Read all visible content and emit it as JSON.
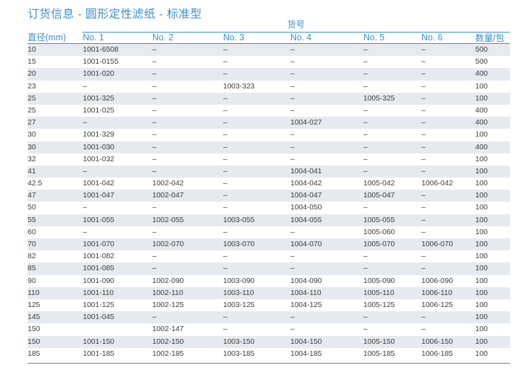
{
  "title": "订货信息 - 圆形定性滤纸 - 标准型",
  "group_header": "货号",
  "columns": {
    "diameter": "直径(mm)",
    "no1": "No. 1",
    "no2": "No. 2",
    "no3": "No. 3",
    "no4": "No. 4",
    "no5": "No. 5",
    "no6": "No. 6",
    "qty": "数量/包"
  },
  "rows": [
    {
      "d": "10",
      "n1": "1001-6508",
      "n2": "–",
      "n3": "–",
      "n4": "–",
      "n5": "–",
      "n6": "–",
      "q": "500"
    },
    {
      "d": "15",
      "n1": "1001-0155",
      "n2": "–",
      "n3": "–",
      "n4": "–",
      "n5": "–",
      "n6": "–",
      "q": "500"
    },
    {
      "d": "20",
      "n1": "1001-020",
      "n2": "–",
      "n3": "–",
      "n4": "–",
      "n5": "–",
      "n6": "–",
      "q": "400"
    },
    {
      "d": "23",
      "n1": "–",
      "n2": "–",
      "n3": "1003-323",
      "n4": "–",
      "n5": "–",
      "n6": "–",
      "q": "100"
    },
    {
      "d": "25",
      "n1": "1001-325",
      "n2": "–",
      "n3": "–",
      "n4": "–",
      "n5": "1005-325",
      "n6": "–",
      "q": "100"
    },
    {
      "d": "25",
      "n1": "1001-025",
      "n2": "–",
      "n3": "–",
      "n4": "–",
      "n5": "–",
      "n6": "–",
      "q": "400"
    },
    {
      "d": "27",
      "n1": "–",
      "n2": "–",
      "n3": "–",
      "n4": "1004-027",
      "n5": "–",
      "n6": "–",
      "q": "400"
    },
    {
      "d": "30",
      "n1": "1001-329",
      "n2": "–",
      "n3": "–",
      "n4": "–",
      "n5": "–",
      "n6": "–",
      "q": "100"
    },
    {
      "d": "30",
      "n1": "1001-030",
      "n2": "–",
      "n3": "–",
      "n4": "–",
      "n5": "–",
      "n6": "–",
      "q": "400"
    },
    {
      "d": "32",
      "n1": "1001-032",
      "n2": "–",
      "n3": "–",
      "n4": "–",
      "n5": "–",
      "n6": "–",
      "q": "100"
    },
    {
      "d": "41",
      "n1": "–",
      "n2": "–",
      "n3": "–",
      "n4": "1004-041",
      "n5": "–",
      "n6": "–",
      "q": "100"
    },
    {
      "d": "42.5",
      "n1": "1001-042",
      "n2": "1002-042",
      "n3": "–",
      "n4": "1004-042",
      "n5": "1005-042",
      "n6": "1006-042",
      "q": "100"
    },
    {
      "d": "47",
      "n1": "1001-047",
      "n2": "1002-047",
      "n3": "–",
      "n4": "1004-047",
      "n5": "1005-047",
      "n6": "–",
      "q": "100"
    },
    {
      "d": "50",
      "n1": "–",
      "n2": "–",
      "n3": "–",
      "n4": "1004-050",
      "n5": "–",
      "n6": "–",
      "q": "100"
    },
    {
      "d": "55",
      "n1": "1001-055",
      "n2": "1002-055",
      "n3": "1003-055",
      "n4": "1004-055",
      "n5": "1005-055",
      "n6": "–",
      "q": "100"
    },
    {
      "d": "60",
      "n1": "–",
      "n2": "–",
      "n3": "–",
      "n4": "–",
      "n5": "1005-060",
      "n6": "–",
      "q": "100"
    },
    {
      "d": "70",
      "n1": "1001-070",
      "n2": "1002-070",
      "n3": "1003-070",
      "n4": "1004-070",
      "n5": "1005-070",
      "n6": "1006-070",
      "q": "100"
    },
    {
      "d": "82",
      "n1": "1001-082",
      "n2": "–",
      "n3": "–",
      "n4": "–",
      "n5": "–",
      "n6": "–",
      "q": "100"
    },
    {
      "d": "85",
      "n1": "1001-085",
      "n2": "–",
      "n3": "–",
      "n4": "–",
      "n5": "–",
      "n6": "–",
      "q": "100"
    },
    {
      "d": "90",
      "n1": "1001-090",
      "n2": "1002-090",
      "n3": "1003-090",
      "n4": "1004-090",
      "n5": "1005-090",
      "n6": "1006-090",
      "q": "100"
    },
    {
      "d": "110",
      "n1": "1001-110",
      "n2": "1002-110",
      "n3": "1003-110",
      "n4": "1004-110",
      "n5": "1005-110",
      "n6": "1006-110",
      "q": "100"
    },
    {
      "d": "125",
      "n1": "1001-125",
      "n2": "1002-125",
      "n3": "1003-125",
      "n4": "1004-125",
      "n5": "1005-125",
      "n6": "1006-125",
      "q": "100"
    },
    {
      "d": "145",
      "n1": "1001-045",
      "n2": "–",
      "n3": "–",
      "n4": "–",
      "n5": "–",
      "n6": "–",
      "q": "100"
    },
    {
      "d": "150",
      "n1": "",
      "n2": "1002-147",
      "n3": "–",
      "n4": "–",
      "n5": "–",
      "n6": "–",
      "q": "100"
    },
    {
      "d": "150",
      "n1": "1001-150",
      "n2": "1002-150",
      "n3": "1003-150",
      "n4": "1004-150",
      "n5": "1005-150",
      "n6": "1006-150",
      "q": "100"
    },
    {
      "d": "185",
      "n1": "1001-185",
      "n2": "1002-185",
      "n3": "1003-185",
      "n4": "1004-185",
      "n5": "1005-185",
      "n6": "1006-185",
      "q": "100"
    }
  ],
  "colors": {
    "accent": "#3a8fd0",
    "row_shade": "#e6e9ee",
    "text": "#3a3a3a"
  }
}
